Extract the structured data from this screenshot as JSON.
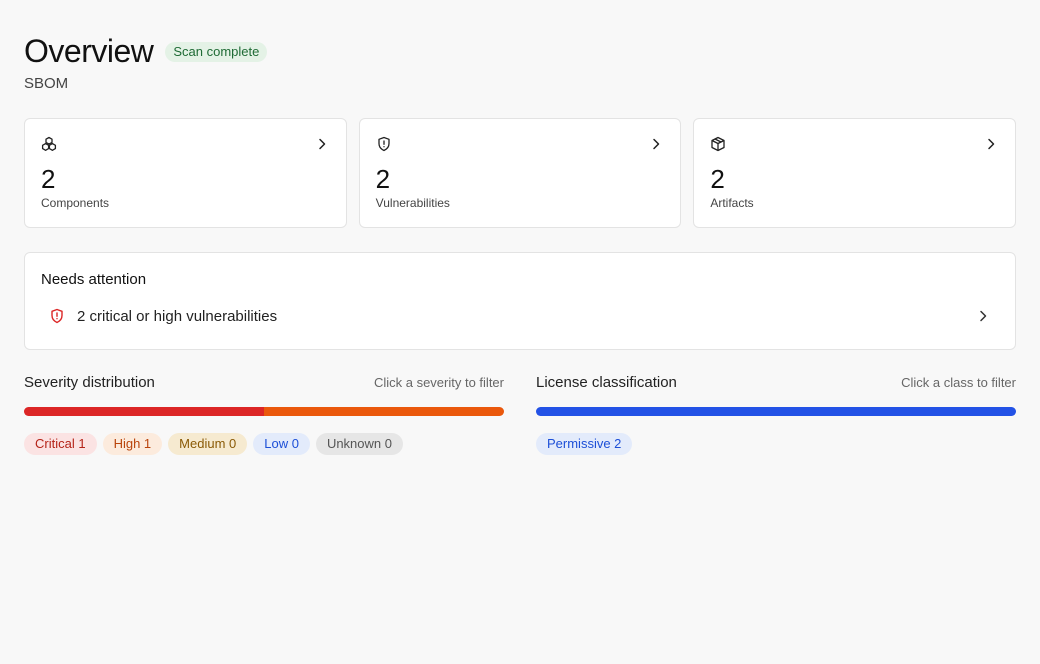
{
  "header": {
    "title": "Overview",
    "status_badge": "Scan complete",
    "subtitle": "SBOM"
  },
  "cards": [
    {
      "count": "2",
      "label": "Components",
      "icon": "components-icon"
    },
    {
      "count": "2",
      "label": "Vulnerabilities",
      "icon": "shield-icon"
    },
    {
      "count": "2",
      "label": "Artifacts",
      "icon": "package-icon"
    }
  ],
  "attention": {
    "title": "Needs attention",
    "item": "2 critical or high vulnerabilities",
    "icon": "alert-shield-icon"
  },
  "severity": {
    "title": "Severity distribution",
    "hint": "Click a severity to filter",
    "chips": [
      {
        "label": "Critical 1",
        "name": "Critical",
        "count": 1,
        "color": "#dc2626"
      },
      {
        "label": "High 1",
        "name": "High",
        "count": 1,
        "color": "#ea580c"
      },
      {
        "label": "Medium 0",
        "name": "Medium",
        "count": 0,
        "color": "#d97706"
      },
      {
        "label": "Low 0",
        "name": "Low",
        "count": 0,
        "color": "#2563eb"
      },
      {
        "label": "Unknown 0",
        "name": "Unknown",
        "count": 0,
        "color": "#9ca3af"
      }
    ]
  },
  "license": {
    "title": "License classification",
    "hint": "Click a class to filter",
    "chips": [
      {
        "label": "Permissive 2",
        "name": "Permissive",
        "count": 2,
        "color": "#2352e6"
      }
    ]
  }
}
